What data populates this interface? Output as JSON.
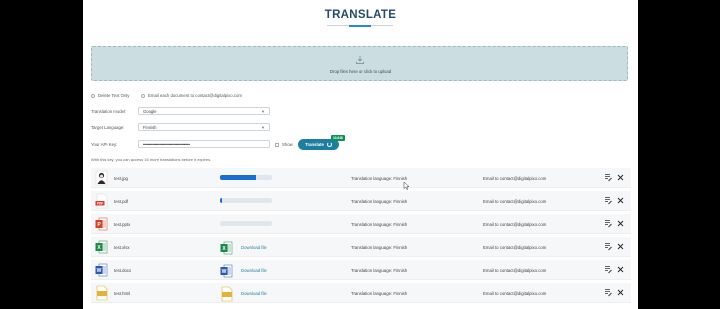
{
  "header": {
    "title": "TRANSLATE"
  },
  "dropzone": {
    "text": "Drop files here or click to upload"
  },
  "options": {
    "delete_text_only": "Delete Text Only",
    "email_each": "Email each document to contact@digitalpixo.com"
  },
  "form": {
    "model_label": "Translation model:",
    "model_value": "Google",
    "language_label": "Target Language:",
    "language_value": "Finnish",
    "api_label": "Your API Key:",
    "api_value": "••••••••••••••••••••••••••••••••••••••••",
    "show_label": "Show",
    "translate_label": "Translate",
    "badge": "10.64$",
    "note": "With this key, you can access 16 more translations before it expires."
  },
  "files": [
    {
      "name": "test.jpg",
      "type": "jpg",
      "progress": 0.7,
      "status": "progress",
      "language": "Translation language: Finnish",
      "email": "Email to contact@digitalpixo.com"
    },
    {
      "name": "test.pdf",
      "type": "pdf",
      "progress": 0.03,
      "status": "progress",
      "language": "Translation language: Finnish",
      "email": "Email to contact@digitalpixo.com"
    },
    {
      "name": "test.pptx",
      "type": "pptx",
      "progress": 0.0,
      "status": "progress",
      "language": "Translation language: Finnish",
      "email": "Email to contact@digitalpixo.com"
    },
    {
      "name": "test.xlsx",
      "type": "xlsx",
      "status": "done",
      "download": "Download file",
      "language": "Translation language: Finnish",
      "email": "Email to contact@digitalpixo.com"
    },
    {
      "name": "test.docx",
      "type": "docx",
      "status": "done",
      "download": "Download file",
      "language": "Translation language: Finnish",
      "email": "Email to contact@digitalpixo.com"
    },
    {
      "name": "test.html",
      "type": "html",
      "status": "done",
      "download": "Download file",
      "language": "Translation language: Finnish",
      "email": "Email to contact@digitalpixo.com"
    }
  ],
  "colors": {
    "accent": "#1c7fa1",
    "title": "#264b6d",
    "dropzone": "#cbdde1",
    "progress": "#1a6ed0"
  }
}
